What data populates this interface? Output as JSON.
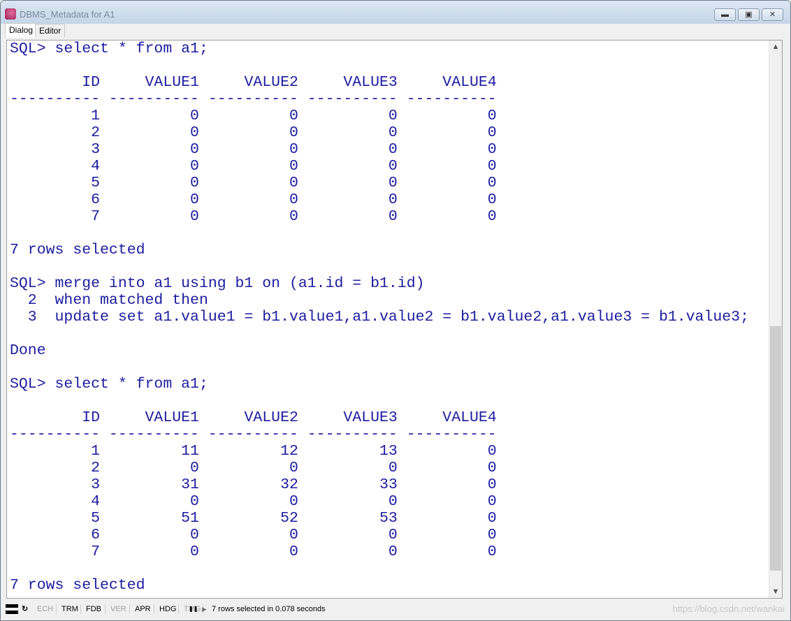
{
  "window": {
    "title": "DBMS_Metadata for A1",
    "minimize": "▬",
    "maximize": "▣",
    "close": "✕"
  },
  "tabs": [
    {
      "label": "Dialog",
      "active": true
    },
    {
      "label": "Editor",
      "active": false
    }
  ],
  "console": {
    "lines_before": [
      "SQL> select * from a1;",
      ""
    ],
    "table1": {
      "headers": [
        "ID",
        "VALUE1",
        "VALUE2",
        "VALUE3",
        "VALUE4"
      ],
      "rows": [
        [
          1,
          0,
          0,
          0,
          0
        ],
        [
          2,
          0,
          0,
          0,
          0
        ],
        [
          3,
          0,
          0,
          0,
          0
        ],
        [
          4,
          0,
          0,
          0,
          0
        ],
        [
          5,
          0,
          0,
          0,
          0
        ],
        [
          6,
          0,
          0,
          0,
          0
        ],
        [
          7,
          0,
          0,
          0,
          0
        ]
      ]
    },
    "lines_middle": [
      "",
      "7 rows selected",
      "",
      "SQL> merge into a1 using b1 on (a1.id = b1.id)",
      "  2  when matched then",
      "  3  update set a1.value1 = b1.value1,a1.value2 = b1.value2,a1.value3 = b1.value3;",
      "",
      "Done",
      "",
      "SQL> select * from a1;",
      ""
    ],
    "table2": {
      "headers": [
        "ID",
        "VALUE1",
        "VALUE2",
        "VALUE3",
        "VALUE4"
      ],
      "rows": [
        [
          1,
          11,
          12,
          13,
          0
        ],
        [
          2,
          0,
          0,
          0,
          0
        ],
        [
          3,
          31,
          32,
          33,
          0
        ],
        [
          4,
          0,
          0,
          0,
          0
        ],
        [
          5,
          51,
          52,
          53,
          0
        ],
        [
          6,
          0,
          0,
          0,
          0
        ],
        [
          7,
          0,
          0,
          0,
          0
        ]
      ]
    },
    "lines_after": [
      "",
      "7 rows selected"
    ]
  },
  "status": {
    "toggles": [
      {
        "label": "ECH",
        "enabled": false
      },
      {
        "label": "TRM",
        "enabled": true
      },
      {
        "label": "FDB",
        "enabled": true
      },
      {
        "label": "VER",
        "enabled": false
      },
      {
        "label": "APR",
        "enabled": true
      },
      {
        "label": "HDG",
        "enabled": true
      },
      {
        "label": "TMG",
        "enabled": false
      }
    ],
    "message": "7 rows selected in 0.078 seconds",
    "watermark": "https://blog.csdn.net/wankai"
  }
}
